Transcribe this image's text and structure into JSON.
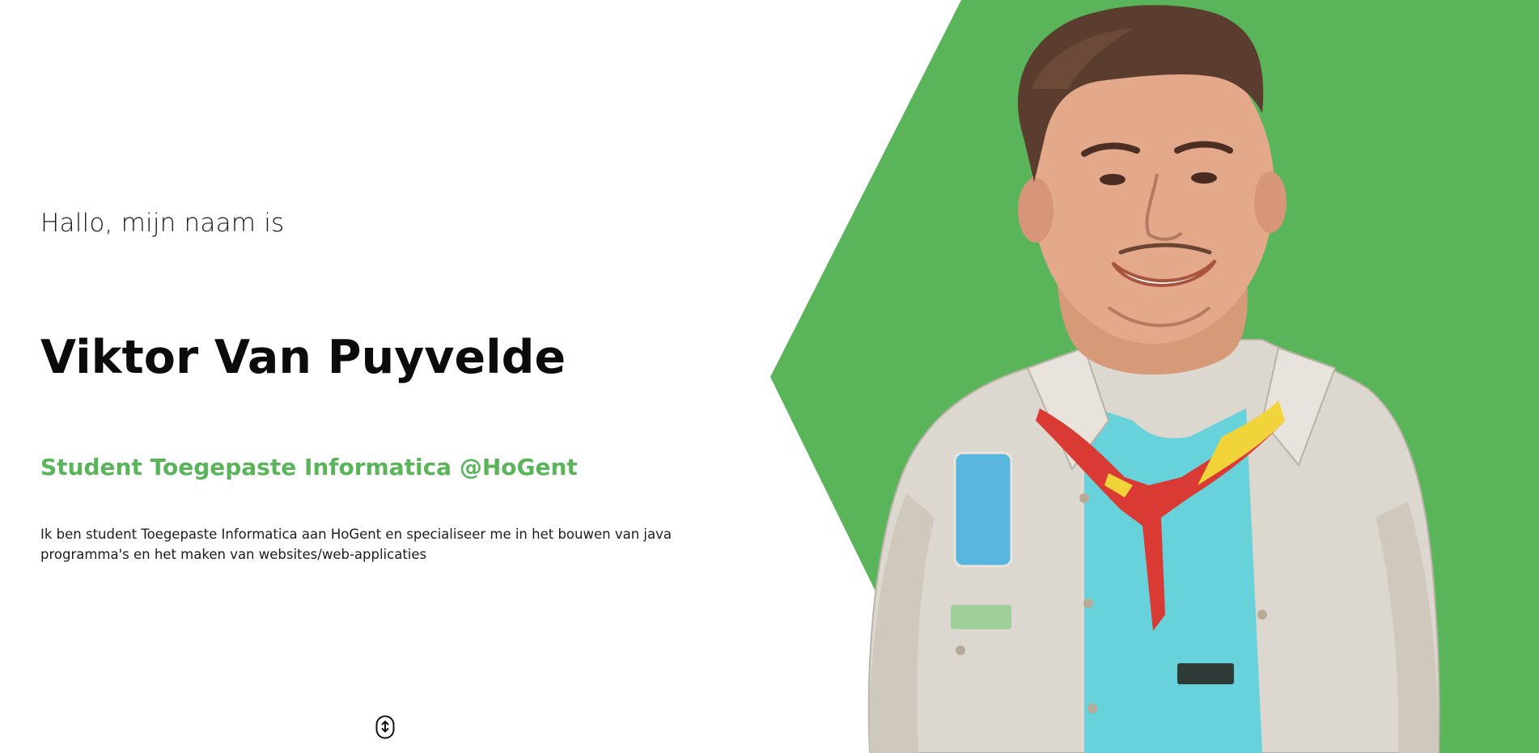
{
  "hero": {
    "greeting": "Hallo, mijn naam is",
    "name": "Viktor Van Puyvelde",
    "subtitle": "Student Toegepaste Informatica @HoGent",
    "description": "Ik ben student Toegepaste Informatica aan HoGent en specialiseer me in het bouwen van java programma's en het maken van websites/web-applicaties"
  },
  "colors": {
    "accent": "#5ab55a",
    "text": "#111111",
    "background": "#ffffff"
  },
  "icons": {
    "scroll": "mouse-scroll-icon"
  }
}
